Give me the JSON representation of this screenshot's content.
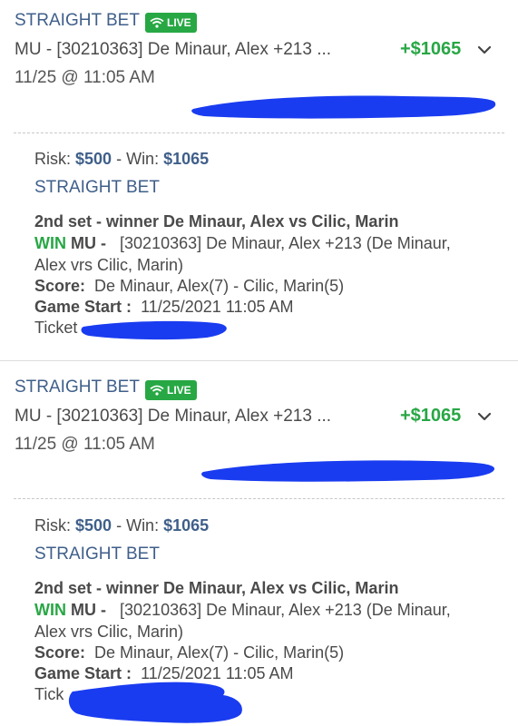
{
  "bets": [
    {
      "header": {
        "title": "STRAIGHT BET",
        "live_label": "LIVE",
        "description": "MU - [30210363] De Minaur, Alex +213 ...",
        "amount": "+$1065",
        "date": "11/25 @ 11:05 AM"
      },
      "detail": {
        "risk_label": "Risk:",
        "risk_value": "$500",
        "win_label": "- Win:",
        "win_value": "$1065",
        "type": "STRAIGHT BET",
        "market": "2nd set - winner De Minaur, Alex vs Cilic, Marin",
        "result": "WIN",
        "selection_label": "MU -",
        "selection_line1": "[30210363] De Minaur, Alex +213 (De Minaur,",
        "selection_line2": "Alex vrs Cilic, Marin)",
        "score_label": "Score:",
        "score_value": "De Minaur, Alex(7) - Cilic, Marin(5)",
        "game_start_label": "Game Start :",
        "game_start_value": "11/25/2021 11:05 AM",
        "ticket_label": "Ticket"
      }
    },
    {
      "header": {
        "title": "STRAIGHT BET",
        "live_label": "LIVE",
        "description": "MU - [30210363] De Minaur, Alex +213 ...",
        "amount": "+$1065",
        "date": "11/25 @ 11:05 AM"
      },
      "detail": {
        "risk_label": "Risk:",
        "risk_value": "$500",
        "win_label": "- Win:",
        "win_value": "$1065",
        "type": "STRAIGHT BET",
        "market": "2nd set - winner De Minaur, Alex vs Cilic, Marin",
        "result": "WIN",
        "selection_label": "MU -",
        "selection_line1": "[30210363] De Minaur, Alex +213 (De Minaur,",
        "selection_line2": "Alex vrs Cilic, Marin)",
        "score_label": "Score:",
        "score_value": "De Minaur, Alex(7) - Cilic, Marin(5)",
        "game_start_label": "Game Start :",
        "game_start_value": "11/25/2021 11:05 AM",
        "ticket_label": "Tick"
      }
    }
  ],
  "colors": {
    "title_blue": "#3f5f8a",
    "live_green": "#27a844",
    "win_green": "#28a745",
    "redaction_blue": "#1a3cf0"
  }
}
